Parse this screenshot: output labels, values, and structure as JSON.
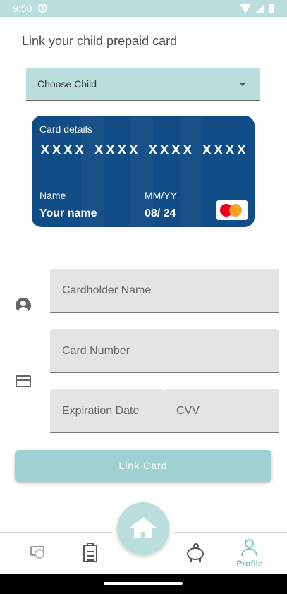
{
  "status_bar": {
    "time": "9:50"
  },
  "page": {
    "heading": "Link your child prepaid card"
  },
  "child_select": {
    "selected": "Choose Child"
  },
  "card": {
    "title": "Card details",
    "number_groups": [
      "XXXX",
      "XXXX",
      "XXXX",
      "XXXX"
    ],
    "name_label": "Name",
    "name_value": "Your name",
    "expiry_label": "MM/YY",
    "expiry_value": "08/ 24",
    "brand": "mastercard"
  },
  "form": {
    "cardholder_placeholder": "Cardholder Name",
    "card_number_placeholder": "Card Number",
    "expiration_placeholder": "Expiration Date",
    "cvv_placeholder": "CVV"
  },
  "actions": {
    "link_card": "Link Card"
  },
  "nav": {
    "items": [
      {
        "id": "cards",
        "icon": "card-icon"
      },
      {
        "id": "tasks",
        "icon": "clipboard-icon"
      },
      {
        "id": "home",
        "icon": "home-icon"
      },
      {
        "id": "savings",
        "icon": "piggy-bank-icon"
      },
      {
        "id": "profile",
        "icon": "person-icon",
        "label": "Profile",
        "active": true
      }
    ]
  },
  "colors": {
    "accent": "#b9dedd",
    "button": "#9ed2d0",
    "active_nav": "#7cc6c3",
    "card": "#104c85"
  }
}
